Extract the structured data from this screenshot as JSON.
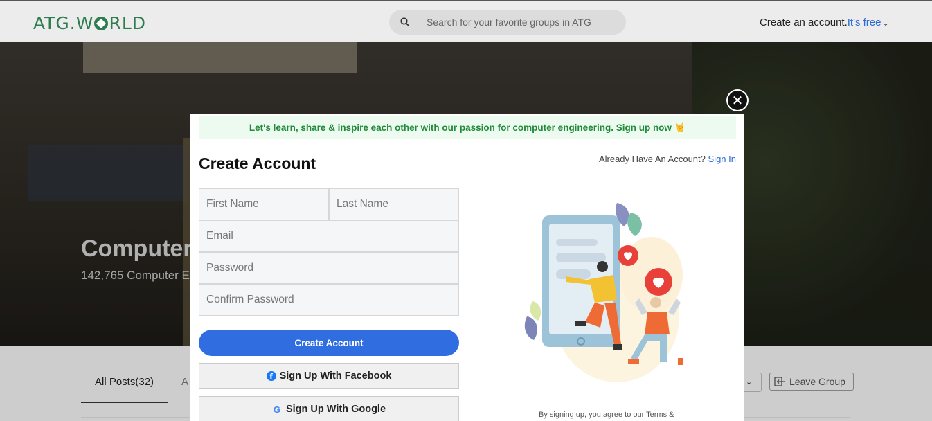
{
  "header": {
    "logo_text_left": "ATG.W",
    "logo_text_right": "RLD",
    "search_placeholder": "Search for your favorite groups in ATG",
    "create_account_label": "Create an account.",
    "create_account_free": "It's free"
  },
  "hero": {
    "title": "Computer",
    "subtitle": "142,765 Computer E"
  },
  "tabs": {
    "all_posts": "All Posts(32)",
    "second_tab_partial": "A",
    "leave_group": "Leave Group"
  },
  "modal": {
    "banner_text": "Let's learn, share & inspire each other with our passion for computer engineering. Sign up now",
    "banner_hand": "🤘",
    "title": "Create Account",
    "already_text": "Already Have An Account?",
    "sign_in": "Sign In",
    "fields": {
      "first_name": "First Name",
      "last_name": "Last Name",
      "email": "Email",
      "password": "Password",
      "confirm_password": "Confirm Password"
    },
    "create_button": "Create Account",
    "facebook_button": "Sign Up With Facebook",
    "google_button": "Sign Up With Google",
    "terms_text": "By signing up, you agree to our Terms &",
    "close_symbol": "✕"
  },
  "icons": {
    "search": "search-icon",
    "close": "close-icon",
    "facebook": "facebook-icon",
    "google": "google-icon",
    "leave": "leave-icon",
    "chevron": "chevron-down-icon"
  },
  "colors": {
    "brand_green": "#2e7d4f",
    "link_blue": "#2c6bd6",
    "primary_button": "#2f6de1",
    "banner_bg": "#edfaef",
    "banner_text": "#1f8a3a"
  }
}
